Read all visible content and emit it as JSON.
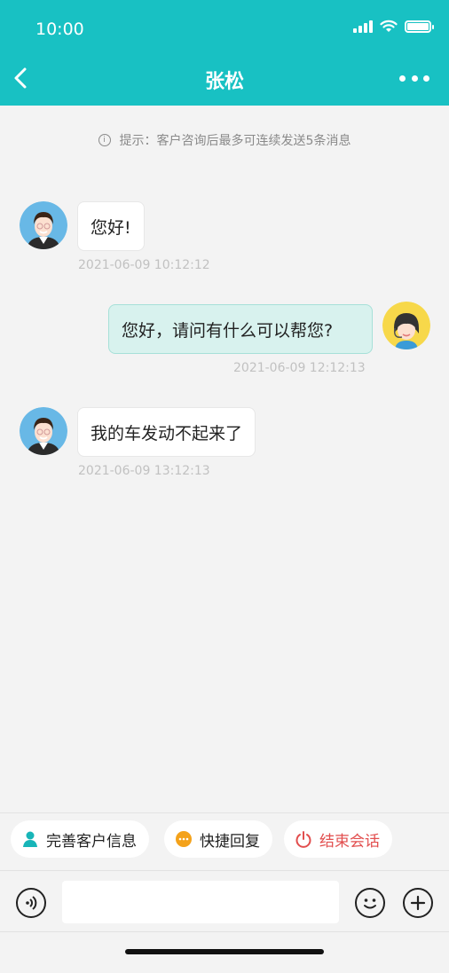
{
  "status_bar": {
    "time": "10:00"
  },
  "nav": {
    "title": "张松"
  },
  "hint": {
    "text": "提示：客户咨询后最多可连续发送5条消息"
  },
  "messages": [
    {
      "side": "left",
      "text": "您好!",
      "time": "2021-06-09 10:12:12"
    },
    {
      "side": "right",
      "text": "您好，请问有什么可以帮您?",
      "time": "2021-06-09 12:12:13"
    },
    {
      "side": "left",
      "text": "我的车发动不起来了",
      "time": "2021-06-09 13:12:13"
    }
  ],
  "quick_actions": {
    "complete_info": "完善客户信息",
    "quick_reply": "快捷回复",
    "end_session": "结束会话"
  },
  "input": {
    "placeholder": ""
  },
  "colors": {
    "header": "#18c1c3",
    "outgoing_bubble": "#d8f2ee",
    "end_session": "#e24e4e",
    "quick_reply_icon": "#f4a21a"
  },
  "icons": [
    "back-icon",
    "more-icon",
    "info-icon",
    "customer-avatar",
    "agent-avatar",
    "person-icon",
    "chat-dots-icon",
    "power-icon",
    "voice-icon",
    "emoji-icon",
    "plus-icon"
  ]
}
